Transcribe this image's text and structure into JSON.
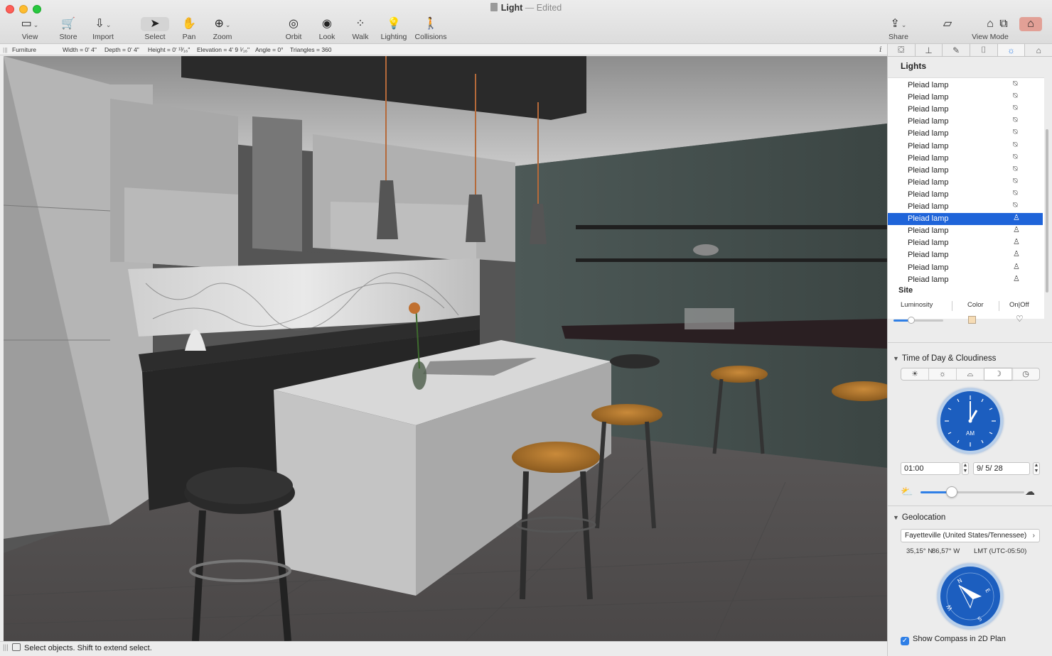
{
  "window": {
    "title": "Light",
    "separator": "—",
    "status": "Edited"
  },
  "toolbar": {
    "left": [
      {
        "id": "view",
        "label": "View",
        "icon": "view-icon",
        "glyph": "▭",
        "caret": true
      },
      {
        "id": "store",
        "label": "Store",
        "icon": "cart-icon",
        "glyph": "🛒"
      },
      {
        "id": "import",
        "label": "Import",
        "icon": "import-icon",
        "glyph": "⇩",
        "caret": true
      },
      {
        "id": "select",
        "label": "Select",
        "icon": "cursor-icon",
        "glyph": "➤"
      },
      {
        "id": "pan",
        "label": "Pan",
        "icon": "hand-icon",
        "glyph": "✋"
      },
      {
        "id": "zoom",
        "label": "Zoom",
        "icon": "zoom-icon",
        "glyph": "⊕",
        "caret": true
      }
    ],
    "center": [
      {
        "id": "orbit",
        "label": "Orbit",
        "icon": "orbit-icon",
        "glyph": "◎"
      },
      {
        "id": "look",
        "label": "Look",
        "icon": "eye-icon",
        "glyph": "◉"
      },
      {
        "id": "walk",
        "label": "Walk",
        "icon": "footsteps-icon",
        "glyph": "⁘"
      },
      {
        "id": "lighting",
        "label": "Lighting",
        "icon": "lightbulb-icon",
        "glyph": "💡"
      },
      {
        "id": "collisions",
        "label": "Collisions",
        "icon": "person-walk-icon",
        "glyph": "🚶"
      }
    ],
    "right": [
      {
        "id": "share",
        "label": "Share",
        "icon": "share-icon",
        "glyph": "⇪",
        "caret": true
      },
      {
        "id": "view-mode",
        "label": "View Mode",
        "icon": "house-icon",
        "glyph": "⌂"
      }
    ]
  },
  "infobar": {
    "category": "Furniture",
    "width": "Width = 0' 4\"",
    "depth": "Depth = 0' 4\"",
    "height": "Height = 0' ¹³⁄₁₆\"",
    "elevation": "Elevation = 4' 9 ¹⁄₁₆\"",
    "angle": "Angle = 0°",
    "triangles": "Triangles = 360"
  },
  "panel": {
    "tabs": [
      {
        "id": "furniture",
        "icon": "furniture-tab-icon",
        "glyph": "⛋"
      },
      {
        "id": "materials",
        "icon": "stamp-tab-icon",
        "glyph": "⊥"
      },
      {
        "id": "edit",
        "icon": "pencil-tab-icon",
        "glyph": "✎"
      },
      {
        "id": "camera",
        "icon": "camera-tab-icon",
        "glyph": "⌷"
      },
      {
        "id": "lights",
        "icon": "sun-tab-icon",
        "glyph": "☼",
        "active": true
      },
      {
        "id": "building",
        "icon": "building-tab-icon",
        "glyph": "⌂"
      }
    ],
    "lights_header": "Lights",
    "lights": [
      {
        "name": "Pleiad lamp",
        "on": false
      },
      {
        "name": "Pleiad lamp",
        "on": false
      },
      {
        "name": "Pleiad lamp",
        "on": false
      },
      {
        "name": "Pleiad lamp",
        "on": false
      },
      {
        "name": "Pleiad lamp",
        "on": false
      },
      {
        "name": "Pleiad lamp",
        "on": false
      },
      {
        "name": "Pleiad lamp",
        "on": false
      },
      {
        "name": "Pleiad lamp",
        "on": false
      },
      {
        "name": "Pleiad lamp",
        "on": false
      },
      {
        "name": "Pleiad lamp",
        "on": false
      },
      {
        "name": "Pleiad lamp",
        "on": false
      },
      {
        "name": "Pleiad lamp",
        "on": true,
        "selected": true
      },
      {
        "name": "Pleiad lamp",
        "on": true
      },
      {
        "name": "Pleiad lamp",
        "on": true
      },
      {
        "name": "Pleiad lamp",
        "on": true
      },
      {
        "name": "Pleiad lamp",
        "on": true
      },
      {
        "name": "Pleiad lamp",
        "on": true
      }
    ],
    "site_label": "Site",
    "props": {
      "luminosity": "Luminosity",
      "color": "Color",
      "onoff": "On|Off",
      "luminosity_level": 0.35,
      "color_value": "#f6dcb5"
    },
    "time_section": {
      "title": "Time of Day & Cloudiness",
      "presets": [
        {
          "id": "sunrise",
          "icon": "sunrise-icon",
          "glyph": "☀"
        },
        {
          "id": "noon",
          "icon": "sun-icon",
          "glyph": "☼"
        },
        {
          "id": "sunset",
          "icon": "sunset-icon",
          "glyph": "⌓"
        },
        {
          "id": "night",
          "icon": "moon-icon",
          "glyph": "☽",
          "active": true
        },
        {
          "id": "custom",
          "icon": "clock-icon",
          "glyph": "◷"
        }
      ],
      "clock_ampm": "AM",
      "time_value": "01:00",
      "date_value": "9/ 5/   28",
      "cloudiness_level": 0.3
    },
    "geo_section": {
      "title": "Geolocation",
      "location": "Fayetteville (United States/Tennessee)",
      "lat": "35,15° N",
      "lon": "86,57° W",
      "tz": "LMT (UTC-05:50)",
      "show_compass_label": "Show Compass in 2D Plan",
      "show_compass_checked": true
    }
  },
  "status": {
    "text": "Select objects. Shift to extend select."
  },
  "colors": {
    "accent": "#1f64d9",
    "clock_face": "#1c5ebf"
  }
}
